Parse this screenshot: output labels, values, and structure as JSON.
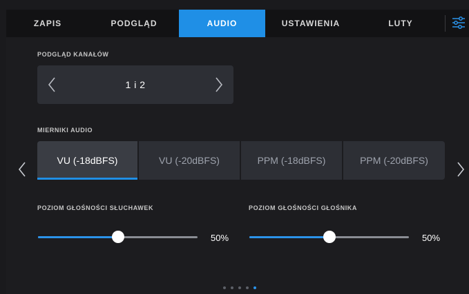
{
  "tabs": [
    {
      "label": "ZAPIS",
      "active": false
    },
    {
      "label": "PODGLĄD",
      "active": false
    },
    {
      "label": "AUDIO",
      "active": true
    },
    {
      "label": "USTAWIENIA",
      "active": false
    },
    {
      "label": "LUTY",
      "active": false
    }
  ],
  "menu_icon": "sliders-icon",
  "channel_preview": {
    "label": "PODGLĄD KANAŁÓW",
    "value": "1 i 2"
  },
  "audio_meters": {
    "label": "MIERNIKI AUDIO",
    "options": [
      "VU (-18dBFS)",
      "VU (-20dBFS)",
      "PPM (-18dBFS)",
      "PPM (-20dBFS)"
    ],
    "selected_index": 0
  },
  "headphone_volume": {
    "label": "POZIOM GŁOŚNOŚCI SŁUCHAWEK",
    "value_text": "50%",
    "level": 0.5
  },
  "speaker_volume": {
    "label": "POZIOM GŁOŚNOŚCI GŁOŚNIKA",
    "value_text": "50%",
    "level": 0.5
  },
  "pagination": {
    "count": 5,
    "current": 5
  },
  "colors": {
    "accent": "#1f8fe6",
    "panel": "#2d2f35",
    "background": "#1c1c1f"
  }
}
